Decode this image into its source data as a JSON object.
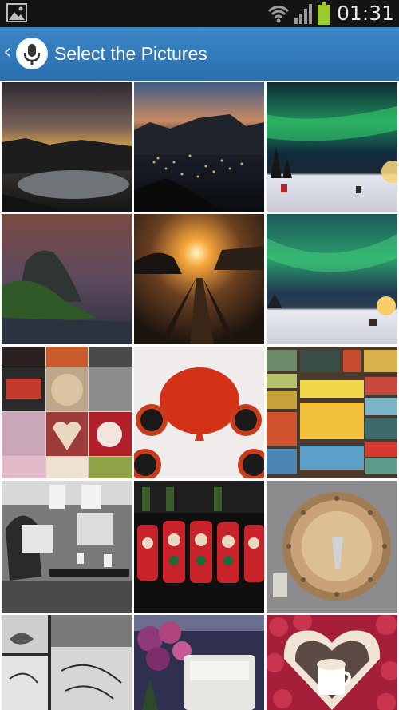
{
  "status_bar": {
    "time": "01:31",
    "icons": [
      "gallery-icon",
      "wifi-icon",
      "signal-icon",
      "battery-icon"
    ]
  },
  "app_bar": {
    "title": "Select the Pictures",
    "icons": [
      "back-chevron-icon",
      "microphone-app-icon"
    ]
  },
  "colors": {
    "app_bar": "#2f7ab9",
    "status_bar": "#141414",
    "battery": "#9ccc2c"
  },
  "pictures": [
    {
      "name": "lagoon-sunset"
    },
    {
      "name": "city-night-from-mountain"
    },
    {
      "name": "aurora-camp"
    },
    {
      "name": "sugarloaf-mountain-dusk"
    },
    {
      "name": "pier-sunset"
    },
    {
      "name": "aurora-bonfire"
    },
    {
      "name": "coffee-collage"
    },
    {
      "name": "red-teapot-cups"
    },
    {
      "name": "vintage-suitcases"
    },
    {
      "name": "newspaper-readers-cafe"
    },
    {
      "name": "starbucks-matryoshka-tins"
    },
    {
      "name": "wooden-clock"
    },
    {
      "name": "sketchbook-drawings"
    },
    {
      "name": "flowers-and-mug"
    },
    {
      "name": "heart-frame-cocoa"
    }
  ]
}
